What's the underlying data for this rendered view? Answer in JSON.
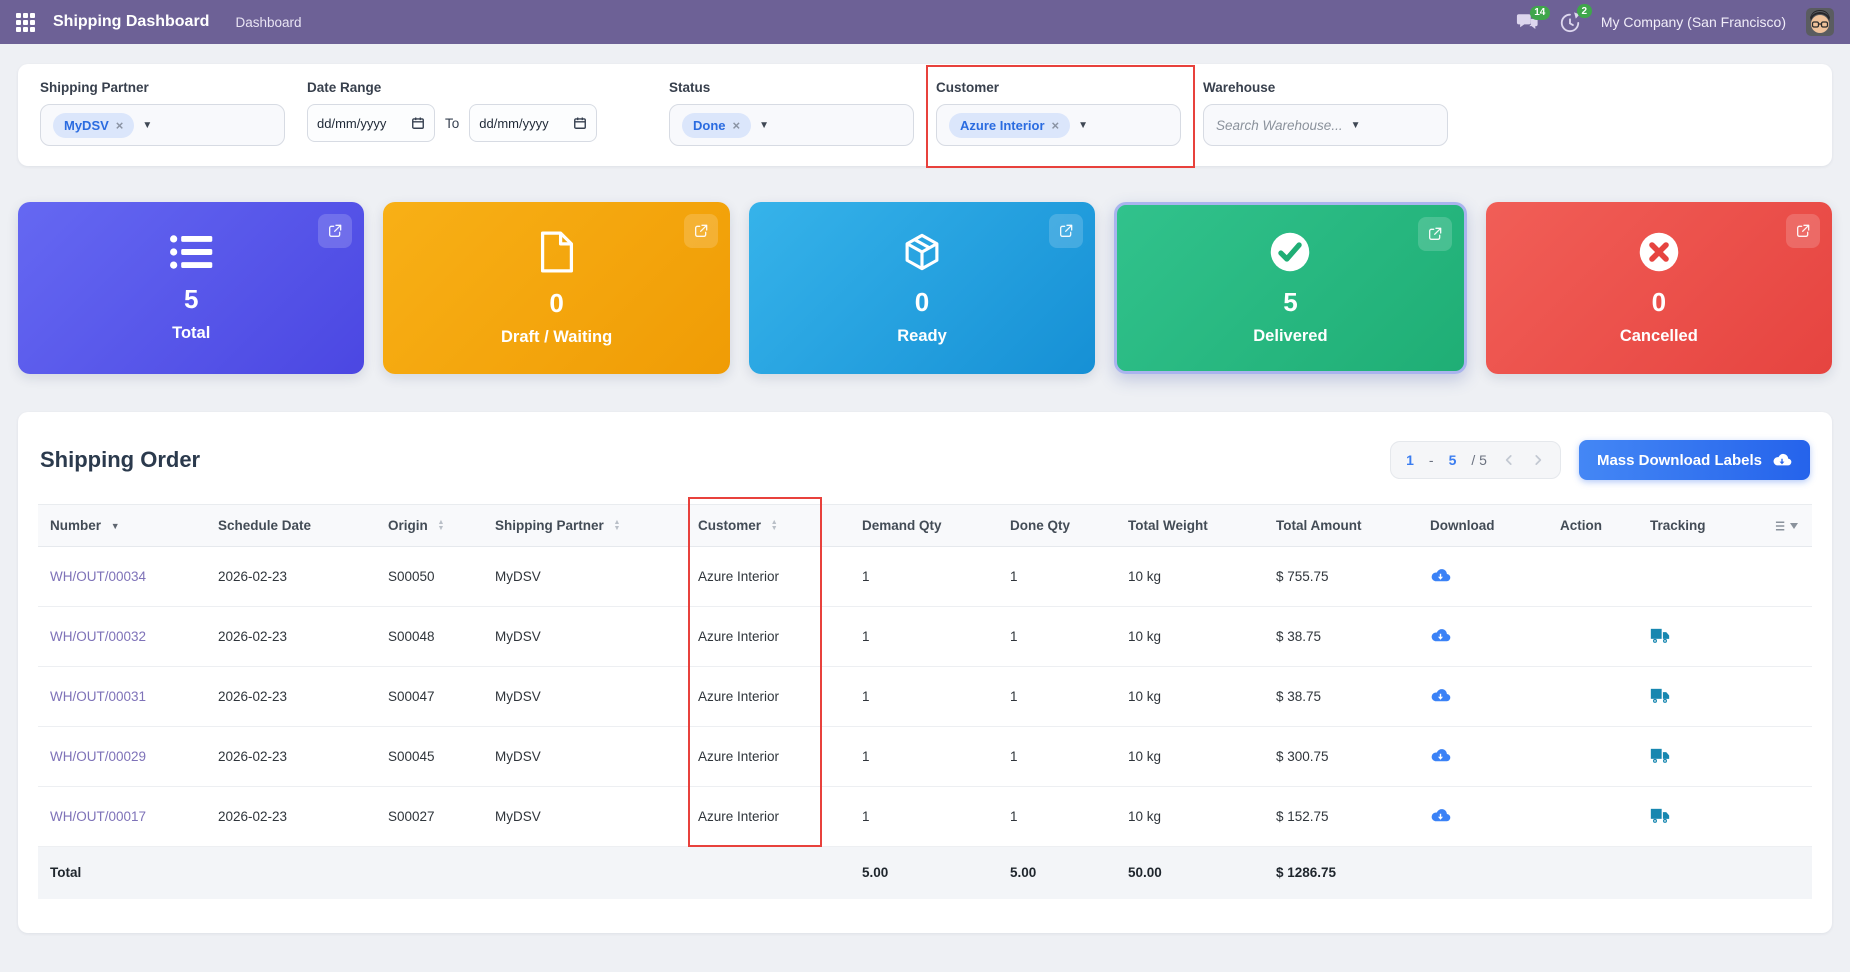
{
  "topbar": {
    "app_title": "Shipping Dashboard",
    "menu": "Dashboard",
    "messages_count": "14",
    "activities_count": "2",
    "company": "My Company (San Francisco)"
  },
  "filters": {
    "shipping_partner": {
      "label": "Shipping Partner",
      "tag": "MyDSV"
    },
    "date_range": {
      "label": "Date Range",
      "from_placeholder": "dd/mm/yyyy",
      "to_label": "To",
      "to_placeholder": "dd/mm/yyyy"
    },
    "status": {
      "label": "Status",
      "tag": "Done"
    },
    "customer": {
      "label": "Customer",
      "tag": "Azure Interior",
      "highlighted": true
    },
    "warehouse": {
      "label": "Warehouse",
      "placeholder": "Search Warehouse..."
    }
  },
  "cards": [
    {
      "name": "total",
      "icon": "list-icon",
      "value": "5",
      "label": "Total",
      "color_from": "#6568f2",
      "color_to": "#4b47e2",
      "selected": false
    },
    {
      "name": "draft-waiting",
      "icon": "document-icon",
      "value": "0",
      "label": "Draft / Waiting",
      "color_from": "#f8b016",
      "color_to": "#f09c05",
      "selected": false
    },
    {
      "name": "ready",
      "icon": "box-icon",
      "value": "0",
      "label": "Ready",
      "color_from": "#36b3ea",
      "color_to": "#1690d5",
      "selected": false
    },
    {
      "name": "delivered",
      "icon": "check-circle-icon",
      "value": "5",
      "label": "Delivered",
      "color_from": "#31c28c",
      "color_to": "#1fae75",
      "selected": true
    },
    {
      "name": "cancelled",
      "icon": "x-circle-icon",
      "value": "0",
      "label": "Cancelled",
      "color_from": "#f15e57",
      "color_to": "#e64440",
      "selected": false
    }
  ],
  "orders": {
    "title": "Shipping Order",
    "pagination": {
      "start": "1",
      "dash": "-",
      "end": "5",
      "total": "/ 5"
    },
    "download_button": "Mass Download Labels",
    "columns": [
      {
        "key": "number",
        "label": "Number",
        "sort": "desc"
      },
      {
        "key": "schedule_date",
        "label": "Schedule Date",
        "sort": ""
      },
      {
        "key": "origin",
        "label": "Origin",
        "sort": "both"
      },
      {
        "key": "shipping_partner",
        "label": "Shipping Partner",
        "sort": "both"
      },
      {
        "key": "customer",
        "label": "Customer",
        "sort": "both"
      },
      {
        "key": "demand_qty",
        "label": "Demand Qty",
        "sort": ""
      },
      {
        "key": "done_qty",
        "label": "Done Qty",
        "sort": ""
      },
      {
        "key": "total_weight",
        "label": "Total Weight",
        "sort": ""
      },
      {
        "key": "total_amount",
        "label": "Total Amount",
        "sort": ""
      },
      {
        "key": "download",
        "label": "Download",
        "sort": ""
      },
      {
        "key": "action",
        "label": "Action",
        "sort": ""
      },
      {
        "key": "tracking",
        "label": "Tracking",
        "sort": ""
      },
      {
        "key": "config",
        "label": "",
        "sort": ""
      }
    ],
    "rows": [
      {
        "number": "WH/OUT/00034",
        "schedule_date": "2026-02-23",
        "origin": "S00050",
        "shipping_partner": "MyDSV",
        "customer": "Azure Interior",
        "demand_qty": "1",
        "done_qty": "1",
        "total_weight": "10 kg",
        "total_amount": "$ 755.75",
        "download": true,
        "tracking": false
      },
      {
        "number": "WH/OUT/00032",
        "schedule_date": "2026-02-23",
        "origin": "S00048",
        "shipping_partner": "MyDSV",
        "customer": "Azure Interior",
        "demand_qty": "1",
        "done_qty": "1",
        "total_weight": "10 kg",
        "total_amount": "$ 38.75",
        "download": true,
        "tracking": true
      },
      {
        "number": "WH/OUT/00031",
        "schedule_date": "2026-02-23",
        "origin": "S00047",
        "shipping_partner": "MyDSV",
        "customer": "Azure Interior",
        "demand_qty": "1",
        "done_qty": "1",
        "total_weight": "10 kg",
        "total_amount": "$ 38.75",
        "download": true,
        "tracking": true
      },
      {
        "number": "WH/OUT/00029",
        "schedule_date": "2026-02-23",
        "origin": "S00045",
        "shipping_partner": "MyDSV",
        "customer": "Azure Interior",
        "demand_qty": "1",
        "done_qty": "1",
        "total_weight": "10 kg",
        "total_amount": "$ 300.75",
        "download": true,
        "tracking": true
      },
      {
        "number": "WH/OUT/00017",
        "schedule_date": "2026-02-23",
        "origin": "S00027",
        "shipping_partner": "MyDSV",
        "customer": "Azure Interior",
        "demand_qty": "1",
        "done_qty": "1",
        "total_weight": "10 kg",
        "total_amount": "$ 152.75",
        "download": true,
        "tracking": true
      }
    ],
    "total_row": {
      "label": "Total",
      "demand_qty": "5.00",
      "done_qty": "5.00",
      "total_weight": "50.00",
      "total_amount": "$ 1286.75"
    }
  },
  "colors": {
    "navbar": "#6d6196",
    "highlight": "#e8413c",
    "accent_blue": "#2563eb",
    "badge_green": "#3fa64b",
    "link_purple": "#7e72b8",
    "cloud_icon": "#3b82f6",
    "truck_icon": "#1787b0"
  }
}
